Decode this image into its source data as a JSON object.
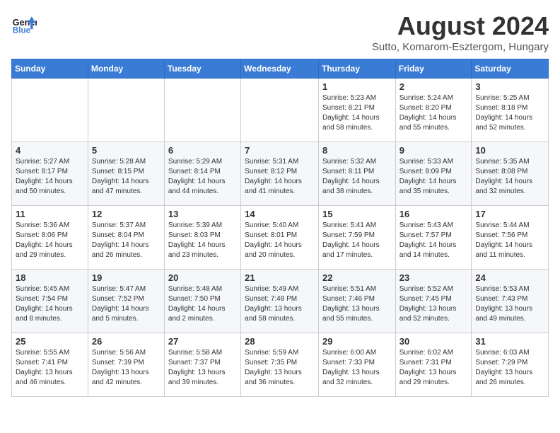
{
  "header": {
    "logo_line1": "General",
    "logo_line2": "Blue",
    "month_title": "August 2024",
    "location": "Sutto, Komarom-Esztergom, Hungary"
  },
  "weekdays": [
    "Sunday",
    "Monday",
    "Tuesday",
    "Wednesday",
    "Thursday",
    "Friday",
    "Saturday"
  ],
  "weeks": [
    [
      {
        "day": "",
        "info": ""
      },
      {
        "day": "",
        "info": ""
      },
      {
        "day": "",
        "info": ""
      },
      {
        "day": "",
        "info": ""
      },
      {
        "day": "1",
        "info": "Sunrise: 5:23 AM\nSunset: 8:21 PM\nDaylight: 14 hours\nand 58 minutes."
      },
      {
        "day": "2",
        "info": "Sunrise: 5:24 AM\nSunset: 8:20 PM\nDaylight: 14 hours\nand 55 minutes."
      },
      {
        "day": "3",
        "info": "Sunrise: 5:25 AM\nSunset: 8:18 PM\nDaylight: 14 hours\nand 52 minutes."
      }
    ],
    [
      {
        "day": "4",
        "info": "Sunrise: 5:27 AM\nSunset: 8:17 PM\nDaylight: 14 hours\nand 50 minutes."
      },
      {
        "day": "5",
        "info": "Sunrise: 5:28 AM\nSunset: 8:15 PM\nDaylight: 14 hours\nand 47 minutes."
      },
      {
        "day": "6",
        "info": "Sunrise: 5:29 AM\nSunset: 8:14 PM\nDaylight: 14 hours\nand 44 minutes."
      },
      {
        "day": "7",
        "info": "Sunrise: 5:31 AM\nSunset: 8:12 PM\nDaylight: 14 hours\nand 41 minutes."
      },
      {
        "day": "8",
        "info": "Sunrise: 5:32 AM\nSunset: 8:11 PM\nDaylight: 14 hours\nand 38 minutes."
      },
      {
        "day": "9",
        "info": "Sunrise: 5:33 AM\nSunset: 8:09 PM\nDaylight: 14 hours\nand 35 minutes."
      },
      {
        "day": "10",
        "info": "Sunrise: 5:35 AM\nSunset: 8:08 PM\nDaylight: 14 hours\nand 32 minutes."
      }
    ],
    [
      {
        "day": "11",
        "info": "Sunrise: 5:36 AM\nSunset: 8:06 PM\nDaylight: 14 hours\nand 29 minutes."
      },
      {
        "day": "12",
        "info": "Sunrise: 5:37 AM\nSunset: 8:04 PM\nDaylight: 14 hours\nand 26 minutes."
      },
      {
        "day": "13",
        "info": "Sunrise: 5:39 AM\nSunset: 8:03 PM\nDaylight: 14 hours\nand 23 minutes."
      },
      {
        "day": "14",
        "info": "Sunrise: 5:40 AM\nSunset: 8:01 PM\nDaylight: 14 hours\nand 20 minutes."
      },
      {
        "day": "15",
        "info": "Sunrise: 5:41 AM\nSunset: 7:59 PM\nDaylight: 14 hours\nand 17 minutes."
      },
      {
        "day": "16",
        "info": "Sunrise: 5:43 AM\nSunset: 7:57 PM\nDaylight: 14 hours\nand 14 minutes."
      },
      {
        "day": "17",
        "info": "Sunrise: 5:44 AM\nSunset: 7:56 PM\nDaylight: 14 hours\nand 11 minutes."
      }
    ],
    [
      {
        "day": "18",
        "info": "Sunrise: 5:45 AM\nSunset: 7:54 PM\nDaylight: 14 hours\nand 8 minutes."
      },
      {
        "day": "19",
        "info": "Sunrise: 5:47 AM\nSunset: 7:52 PM\nDaylight: 14 hours\nand 5 minutes."
      },
      {
        "day": "20",
        "info": "Sunrise: 5:48 AM\nSunset: 7:50 PM\nDaylight: 14 hours\nand 2 minutes."
      },
      {
        "day": "21",
        "info": "Sunrise: 5:49 AM\nSunset: 7:48 PM\nDaylight: 13 hours\nand 58 minutes."
      },
      {
        "day": "22",
        "info": "Sunrise: 5:51 AM\nSunset: 7:46 PM\nDaylight: 13 hours\nand 55 minutes."
      },
      {
        "day": "23",
        "info": "Sunrise: 5:52 AM\nSunset: 7:45 PM\nDaylight: 13 hours\nand 52 minutes."
      },
      {
        "day": "24",
        "info": "Sunrise: 5:53 AM\nSunset: 7:43 PM\nDaylight: 13 hours\nand 49 minutes."
      }
    ],
    [
      {
        "day": "25",
        "info": "Sunrise: 5:55 AM\nSunset: 7:41 PM\nDaylight: 13 hours\nand 46 minutes."
      },
      {
        "day": "26",
        "info": "Sunrise: 5:56 AM\nSunset: 7:39 PM\nDaylight: 13 hours\nand 42 minutes."
      },
      {
        "day": "27",
        "info": "Sunrise: 5:58 AM\nSunset: 7:37 PM\nDaylight: 13 hours\nand 39 minutes."
      },
      {
        "day": "28",
        "info": "Sunrise: 5:59 AM\nSunset: 7:35 PM\nDaylight: 13 hours\nand 36 minutes."
      },
      {
        "day": "29",
        "info": "Sunrise: 6:00 AM\nSunset: 7:33 PM\nDaylight: 13 hours\nand 32 minutes."
      },
      {
        "day": "30",
        "info": "Sunrise: 6:02 AM\nSunset: 7:31 PM\nDaylight: 13 hours\nand 29 minutes."
      },
      {
        "day": "31",
        "info": "Sunrise: 6:03 AM\nSunset: 7:29 PM\nDaylight: 13 hours\nand 26 minutes."
      }
    ]
  ]
}
